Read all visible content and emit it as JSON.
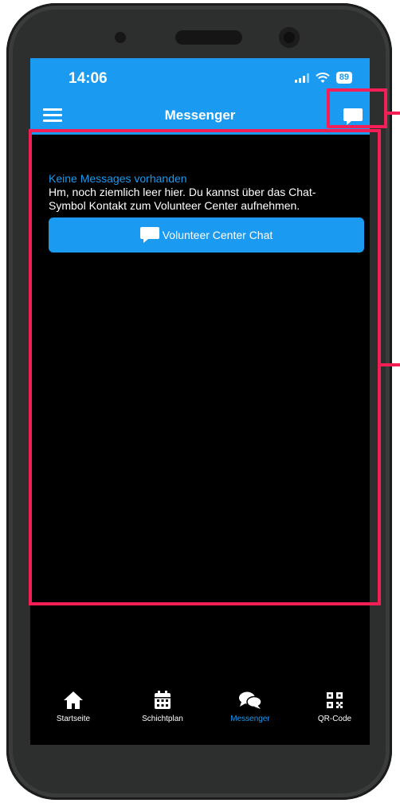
{
  "statusbar": {
    "time": "14:06",
    "battery": "89"
  },
  "appbar": {
    "title": "Messenger"
  },
  "messenger": {
    "empty_title": "Keine Messages vorhanden",
    "empty_text": "Hm, noch ziemlich leer hier. Du kannst über das Chat-Symbol Kontakt zum Volunteer Center aufnehmen.",
    "chat_button_label": "Volunteer Center Chat"
  },
  "tabs": [
    {
      "label": "Startseite",
      "icon": "home-icon"
    },
    {
      "label": "Schichtplan",
      "icon": "calendar-icon"
    },
    {
      "label": "Messenger",
      "icon": "chat-bubbles-icon",
      "active": true
    },
    {
      "label": "QR-Code",
      "icon": "qr-code-icon"
    }
  ],
  "colors": {
    "accent": "#1a9af0",
    "annotation": "#f51e55",
    "background": "#000000"
  }
}
